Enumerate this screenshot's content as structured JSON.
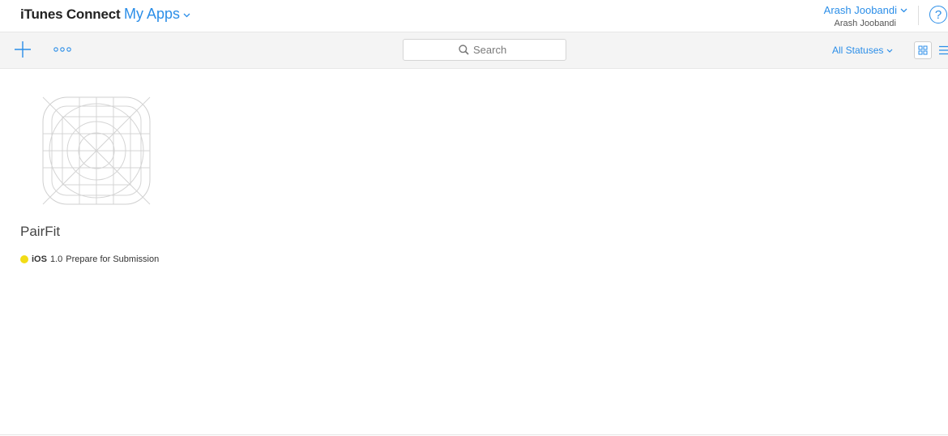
{
  "header": {
    "brand": "iTunes Connect",
    "section": "My Apps",
    "user_name": "Arash Joobandi",
    "user_team": "Arash Joobandi",
    "help_label": "?"
  },
  "toolbar": {
    "search_placeholder": "Search",
    "status_filter": "All Statuses"
  },
  "apps": [
    {
      "name": "PairFit",
      "platform": "iOS",
      "version": "1.0",
      "status": "Prepare for Submission",
      "status_color": "#f2dc16"
    }
  ],
  "colors": {
    "accent": "#2b8ee8",
    "toolbar_bg": "#f4f4f4"
  },
  "icons": [
    "plus-icon",
    "more-icon",
    "search-icon",
    "chevron-down-icon",
    "grid-view-icon",
    "list-view-icon",
    "help-icon",
    "app-placeholder-icon"
  ]
}
